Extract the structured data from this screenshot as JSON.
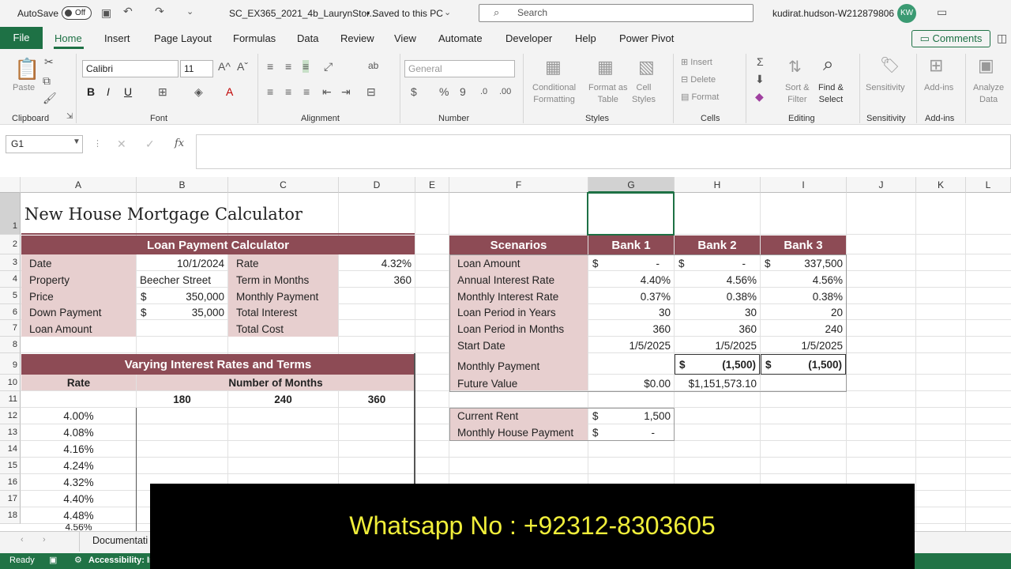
{
  "titlebar": {
    "autosave_label": "AutoSave",
    "autosave_state": "Off",
    "file_title": "SC_EX365_2021_4b_LaurynStor...",
    "saved_status": "• Saved to this PC",
    "search_placeholder": "Search",
    "user": "kudirat.hudson-W212879806",
    "avatar_initials": "KW"
  },
  "menu": {
    "file": "File",
    "tabs": [
      "Home",
      "Insert",
      "Page Layout",
      "Formulas",
      "Data",
      "Review",
      "View",
      "Automate",
      "Developer",
      "Help",
      "Power Pivot"
    ],
    "comments": "Comments"
  },
  "ribbon": {
    "groups": [
      "Clipboard",
      "Font",
      "Alignment",
      "Number",
      "Styles",
      "Cells",
      "Editing",
      "Sensitivity",
      "Add-ins"
    ],
    "paste": "Paste",
    "font_name": "Calibri",
    "font_size": "11",
    "number_format": "General",
    "conditional": [
      "Conditional",
      "Formatting"
    ],
    "format_as": [
      "Format as",
      "Table"
    ],
    "cell_styles": [
      "Cell",
      "Styles"
    ],
    "insert": "Insert",
    "delete": "Delete",
    "format": "Format",
    "sort": [
      "Sort &",
      "Filter"
    ],
    "find": [
      "Find &",
      "Select"
    ],
    "sensitivity": "Sensitivity",
    "addins": "Add-ins",
    "analyze": [
      "Analyze",
      "Data"
    ],
    "bold": "B",
    "italic": "I",
    "underline": "U",
    "dollar": "$",
    "percent": "%",
    "comma": "9"
  },
  "formula_bar": {
    "name_box": "G1",
    "fx": "fx",
    "value": ""
  },
  "columns": [
    "A",
    "B",
    "C",
    "D",
    "E",
    "F",
    "G",
    "H",
    "I",
    "J",
    "K",
    "L"
  ],
  "rows": [
    "1",
    "2",
    "3",
    "4",
    "5",
    "6",
    "7",
    "8",
    "9",
    "10",
    "11",
    "12",
    "13",
    "14",
    "15",
    "16",
    "17",
    "18"
  ],
  "sheet": {
    "title": "New House Mortgage Calculator",
    "loan": {
      "header": "Loan Payment Calculator",
      "labels_left": [
        "Date",
        "Property",
        "Price",
        "Down Payment",
        "Loan Amount"
      ],
      "values_left": [
        "10/1/2024",
        "Beecher Street",
        "350,000",
        "35,000",
        ""
      ],
      "labels_right": [
        "Rate",
        "Term in Months",
        "Monthly Payment",
        "Total Interest",
        "Total Cost"
      ],
      "values_right": [
        "4.32%",
        "360",
        "",
        "",
        ""
      ],
      "currency": "$"
    },
    "varying": {
      "header": "Varying Interest Rates and Terms",
      "rate_label": "Rate",
      "months_label": "Number of Months",
      "months": [
        "180",
        "240",
        "360"
      ],
      "rates": [
        "4.00%",
        "4.08%",
        "4.16%",
        "4.24%",
        "4.32%",
        "4.40%",
        "4.48%",
        "4.56%"
      ]
    },
    "scenarios": {
      "header": "Scenarios",
      "banks": [
        "Bank 1",
        "Bank 2",
        "Bank 3"
      ],
      "labels": [
        "Loan Amount",
        "Annual Interest Rate",
        "Monthly Interest Rate",
        "Loan Period in Years",
        "Loan Period in Months",
        "Start Date",
        "Monthly Payment",
        "Future Value"
      ],
      "bank1": [
        "-",
        "4.40%",
        "0.37%",
        "30",
        "360",
        "1/5/2025",
        "",
        "$0.00"
      ],
      "bank2": [
        "-",
        "4.56%",
        "0.38%",
        "30",
        "360",
        "1/5/2025",
        "(1,500)",
        "$1,151,573.10"
      ],
      "bank3": [
        "337,500",
        "4.56%",
        "0.38%",
        "20",
        "240",
        "1/5/2025",
        "(1,500)",
        ""
      ],
      "current_rent_label": "Current Rent",
      "current_rent": "1,500",
      "monthly_house_label": "Monthly House Payment",
      "monthly_house": "-"
    }
  },
  "tabs": {
    "sheet_tab": "Documentati"
  },
  "status": {
    "ready": "Ready",
    "accessibility": "Accessibility: In"
  },
  "overlay": {
    "text": "Whatsapp No : +92312-8303605"
  },
  "colors": {
    "accent": "#1e7145",
    "header_fill": "#8d4b55",
    "label_fill": "#e7cfcf"
  }
}
